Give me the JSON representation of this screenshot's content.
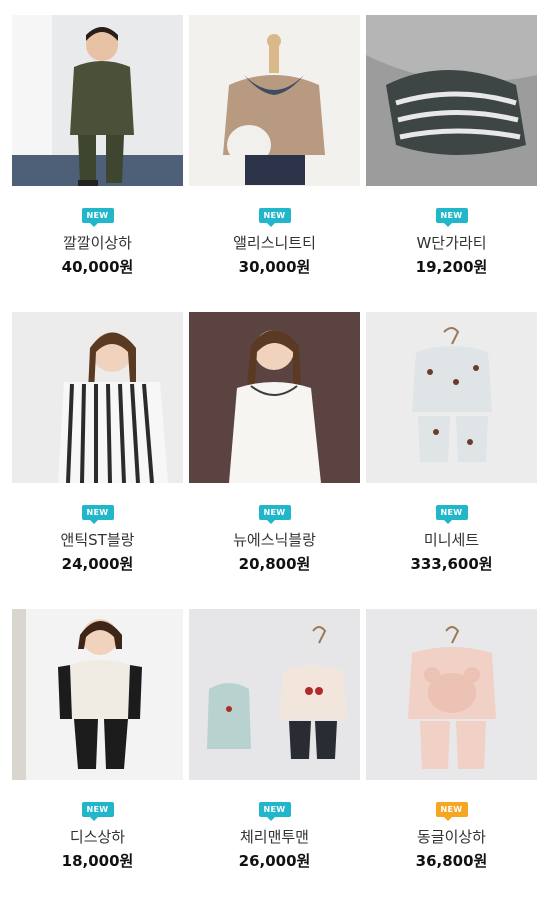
{
  "products": [
    {
      "name": "깔깔이상하",
      "price": "40,000원",
      "badge": "NEW",
      "badge_color": "#21b6c9"
    },
    {
      "name": "앨리스니트티",
      "price": "30,000원",
      "badge": "NEW",
      "badge_color": "#21b6c9"
    },
    {
      "name": "W단가라티",
      "price": "19,200원",
      "badge": "NEW",
      "badge_color": "#21b6c9"
    },
    {
      "name": "앤틱ST블랑",
      "price": "24,000원",
      "badge": "NEW",
      "badge_color": "#21b6c9"
    },
    {
      "name": "뉴에스닉블랑",
      "price": "20,800원",
      "badge": "NEW",
      "badge_color": "#21b6c9"
    },
    {
      "name": "미니세트",
      "price": "333,600원",
      "badge": "NEW",
      "badge_color": "#21b6c9"
    },
    {
      "name": "디스상하",
      "price": "18,000원",
      "badge": "NEW",
      "badge_color": "#21b6c9"
    },
    {
      "name": "체리맨투맨",
      "price": "26,000원",
      "badge": "NEW",
      "badge_color": "#21b6c9"
    },
    {
      "name": "동글이상하",
      "price": "36,800원",
      "badge": "NEW",
      "badge_color": "#f5a623"
    }
  ]
}
